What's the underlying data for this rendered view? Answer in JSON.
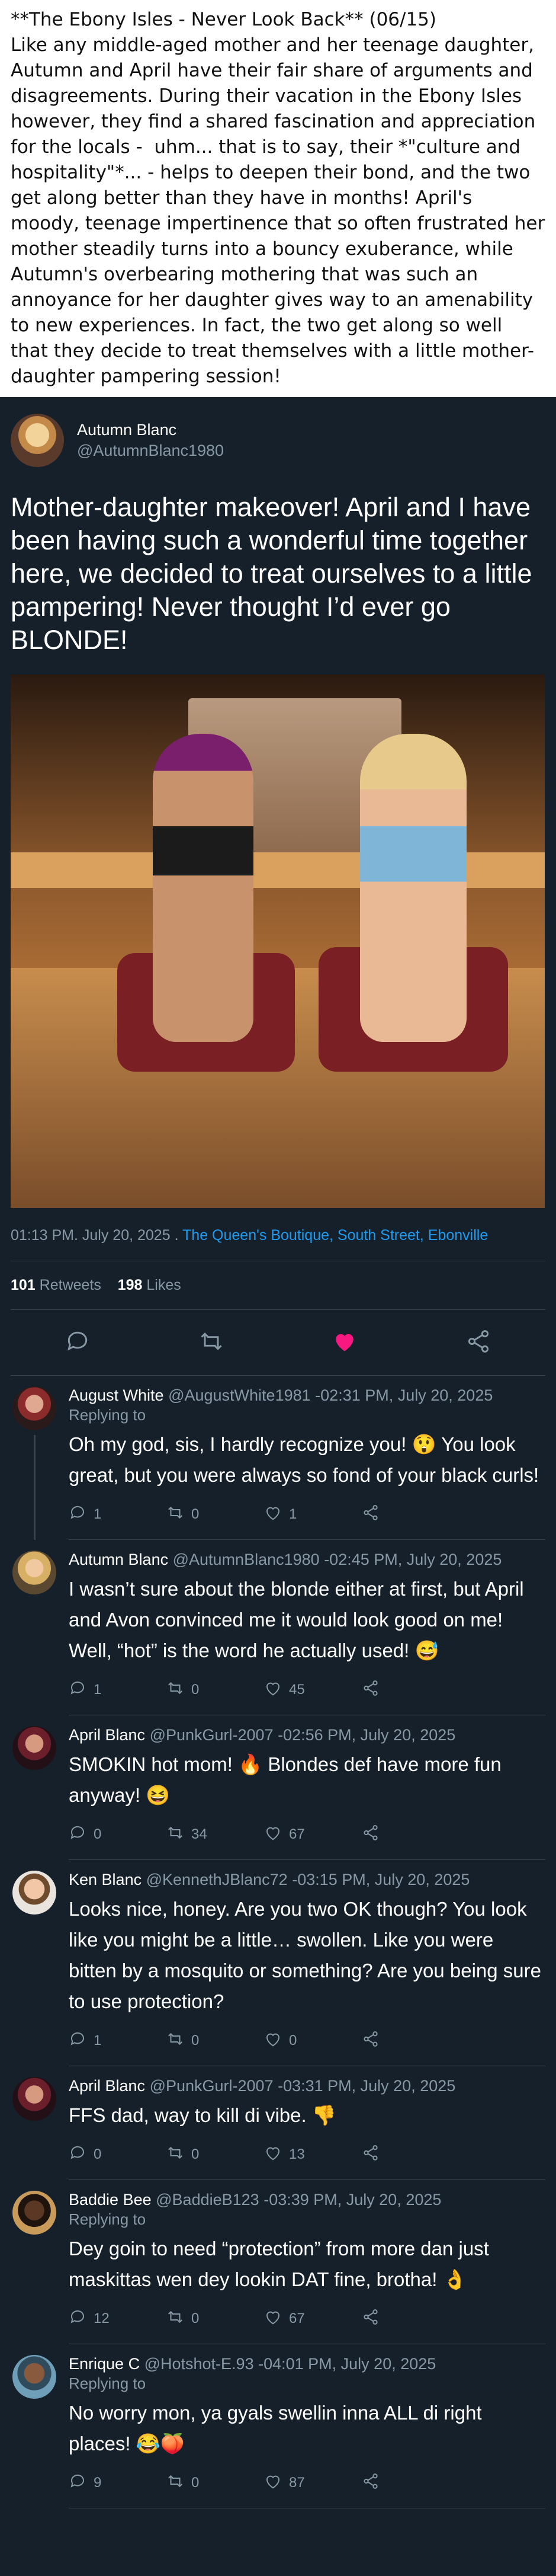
{
  "intro": {
    "text": "**The Ebony Isles - Never Look Back** (06/15)\nLike any middle-aged mother and her teenage daughter, Autumn and April have their fair share of arguments and disagreements. During their vacation in the Ebony Isles however, they find a shared fascination and appreciation for the locals -  uhm... that is to say, their *\"culture and hospitality\"*... - helps to deepen their bond, and the two get along better than they have in months! April's moody, teenage impertinence that so often frustrated her mother steadily turns into a bouncy exuberance, while Autumn's overbearing mothering that was such an annoyance for her daughter gives way to an amenability to new experiences. In fact, the two get along so well that they decide to treat themselves with a little mother-daughter pampering session!"
  },
  "tweet": {
    "author_name": "Autumn Blanc",
    "author_handle": "@AutumnBlanc1980",
    "text": "Mother-daughter makeover! April and I have been having such a wonderful time together here, we decided to treat ourselves to a little pampering! Never thought I’d ever go BLONDE!",
    "time": "01:13 PM. July 20, 2025 . ",
    "location": "The Queen's Boutique, South Street, Ebonville",
    "retweets_count": "101",
    "retweets_label": "Retweets",
    "likes_count": "198",
    "likes_label": "Likes"
  },
  "colors": {
    "accent": "#1d9bf0",
    "like": "#f91880",
    "background": "#15202b",
    "muted": "#8899a6"
  },
  "replies": [
    {
      "name": "August White",
      "handle": "@AugustWhite1981",
      "time": "-02:31 PM, July 20, 2025",
      "replying": "Replying to",
      "text": "Oh my god, sis, I hardly recognize you! 😲 You look great, but you were always so fond of your black curls!",
      "replies": "1",
      "retweets": "0",
      "likes": "1",
      "avatar": "av-red"
    },
    {
      "name": "Autumn Blanc",
      "handle": "@AutumnBlanc1980",
      "time": "-02:45 PM, July 20, 2025",
      "replying": "",
      "text": "I wasn’t sure about the blonde either at first, but April and Avon convinced me it would look good on me! Well, “hot” is the word he actually used! 😅",
      "replies": "1",
      "retweets": "0",
      "likes": "45",
      "avatar": "av-blond"
    },
    {
      "name": "April Blanc",
      "handle": "@PunkGurl-2007",
      "time": "-02:56 PM, July 20, 2025",
      "replying": "",
      "text": "SMOKIN hot mom! 🔥 Blondes def have more fun anyway! 😆",
      "replies": "0",
      "retweets": "34",
      "likes": "67",
      "avatar": "av-dark"
    },
    {
      "name": "Ken Blanc",
      "handle": "@KennethJBlanc72",
      "time": "-03:15 PM, July 20, 2025",
      "replying": "",
      "text": "Looks nice, honey. Are you two OK though? You look like you might be a little… swollen. Like you were bitten by a mosquito or something? Are you being sure to use protection?",
      "replies": "1",
      "retweets": "0",
      "likes": "0",
      "avatar": "av-ken"
    },
    {
      "name": "April Blanc",
      "handle": "@PunkGurl-2007",
      "time": "-03:31 PM, July 20, 2025",
      "replying": "",
      "text": "FFS dad, way to kill di vibe. 👎",
      "replies": "0",
      "retweets": "0",
      "likes": "13",
      "avatar": "av-dark"
    },
    {
      "name": "Baddie Bee",
      "handle": "@BaddieB123",
      "time": "-03:39 PM, July 20, 2025",
      "replying": "Replying to",
      "text": "Dey goin to need “protection” from more dan just maskittas wen dey lookin DAT fine, brotha! 👌",
      "replies": "12",
      "retweets": "0",
      "likes": "67",
      "avatar": "av-baddie"
    },
    {
      "name": "Enrique C",
      "handle": "@Hotshot-E.93",
      "time": "-04:01 PM, July 20, 2025",
      "replying": "Replying to",
      "text": "No worry mon, ya gyals swellin inna ALL di right places! 😂🍑",
      "replies": "9",
      "retweets": "0",
      "likes": "87",
      "avatar": "av-enrique"
    }
  ]
}
